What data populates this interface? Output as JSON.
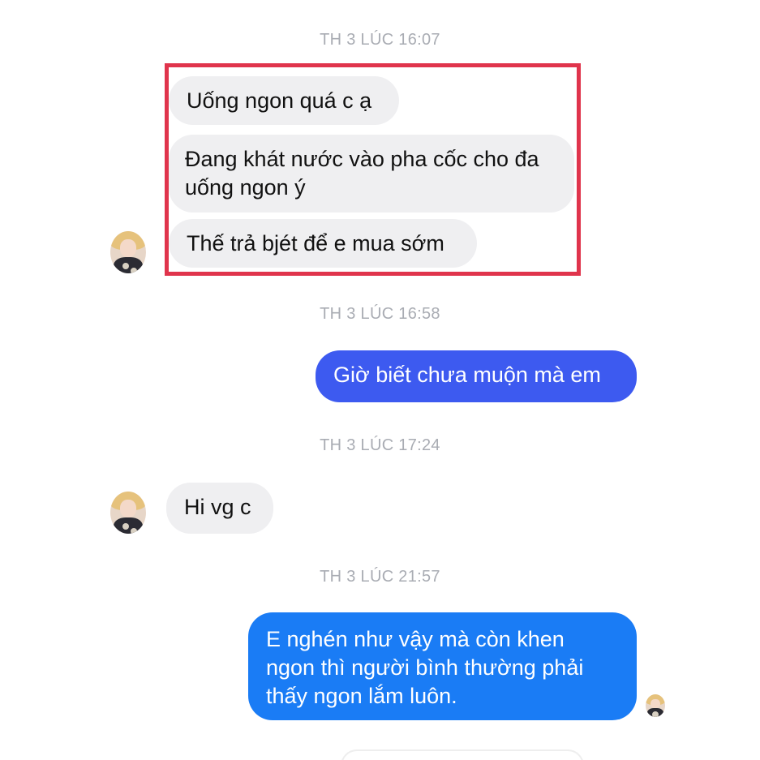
{
  "timestamps": [
    "TH 3 LÚC 16:07",
    "TH 3 LÚC 16:58",
    "TH 3 LÚC 17:24",
    "TH 3 LÚC 21:57"
  ],
  "messages": {
    "m1": "Uống ngon quá c ạ",
    "m2": "Đang khát nước vào pha cốc cho đa uống ngon ý",
    "m3": "Thế trả bjét để e mua sớm",
    "m4": "Giờ biết chưa muộn mà em",
    "m5": "Hi vg c",
    "m6": "E nghén như vậy mà còn khen ngon thì người bình thường phải thấy ngon lắm luôn."
  },
  "colors": {
    "highlight_border": "#e0344c",
    "received_bubble": "#efeff1",
    "sent_bubble_purple": "#3d5af0",
    "sent_bubble_blue": "#1a7cf5",
    "timestamp_text": "#a9acb3"
  }
}
